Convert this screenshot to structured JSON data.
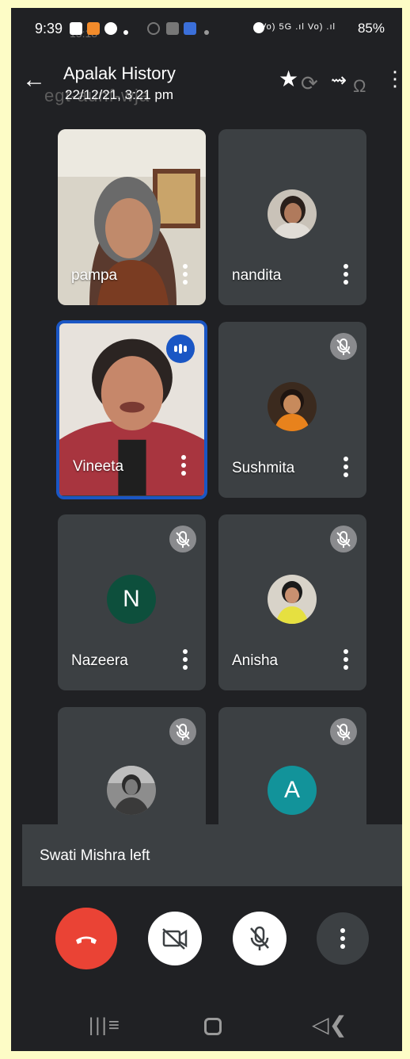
{
  "status_bar": {
    "time": "9:39",
    "ghost_time": "15:18",
    "signal_text": "Vo) 5G .ıl Vo) .ıl",
    "battery": "85%"
  },
  "header": {
    "title": "Apalak History",
    "subtitle": "22/12/21, 3:21 pm",
    "ghost_code": "egt-aunf-wja"
  },
  "participants": [
    {
      "name": "pampa",
      "muted": false,
      "speaking": false,
      "type": "video"
    },
    {
      "name": "nandita",
      "muted": false,
      "speaking": false,
      "type": "photo-avatar"
    },
    {
      "name": "Vineeta",
      "muted": false,
      "speaking": true,
      "type": "video"
    },
    {
      "name": "Sushmita",
      "muted": true,
      "speaking": false,
      "type": "photo-avatar"
    },
    {
      "name": "Nazeera",
      "muted": true,
      "speaking": false,
      "type": "letter-avatar",
      "initial": "N",
      "avatar_color": "#0d4f3c"
    },
    {
      "name": "Anisha",
      "muted": true,
      "speaking": false,
      "type": "photo-avatar"
    },
    {
      "name": "",
      "muted": true,
      "speaking": false,
      "type": "photo-avatar"
    },
    {
      "name": "",
      "muted": true,
      "speaking": false,
      "type": "letter-avatar",
      "initial": "A",
      "avatar_color": "#12939a"
    }
  ],
  "toast": {
    "message": "Swati Mishra left"
  },
  "controls": {
    "end_call_color": "#ea4335",
    "button_bg": "#ffffff",
    "more_bg": "#3c4043"
  },
  "colors": {
    "screen_bg": "#202124",
    "tile_bg": "#3c4043",
    "speaking_border": "#1a56c4",
    "page_bg": "#fdfcc6"
  }
}
